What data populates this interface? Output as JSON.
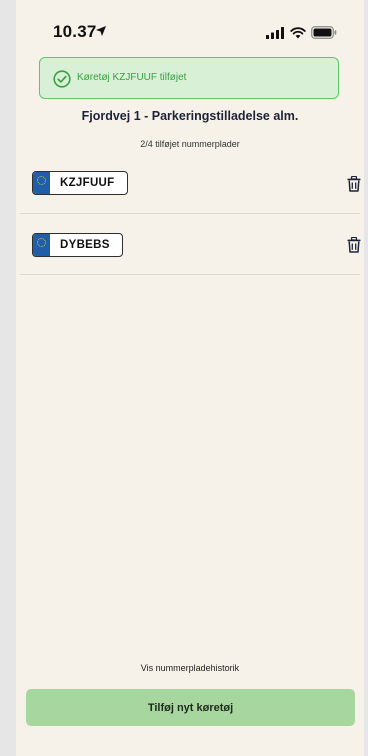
{
  "status_bar": {
    "time": "10.37",
    "icons": [
      "location-arrow-icon",
      "cellular-signal-icon",
      "wifi-icon",
      "battery-icon"
    ]
  },
  "toast": {
    "message": "Køretøj KZJFUUF tilføjet",
    "icon": "check-circle-icon",
    "colors": {
      "border": "#5fc866",
      "background": "#d7f0d6",
      "text": "#3aa042"
    }
  },
  "header": {
    "title": "Fjordvej 1 - Parkeringstilladelse alm.",
    "subtitle": "2/4 tilføjet nummerplader"
  },
  "vehicles": [
    {
      "plate": "KZJFUUF",
      "delete_icon": "trash-icon"
    },
    {
      "plate": "DYBEBS",
      "delete_icon": "trash-icon"
    }
  ],
  "footer": {
    "history_link": "Vis nummerpladehistorik",
    "add_button": "Tilføj nyt køretøj"
  },
  "colors": {
    "background": "#f6f2ea",
    "eu_band": "#1f5fa8",
    "primary_button": "#a7d79f"
  }
}
